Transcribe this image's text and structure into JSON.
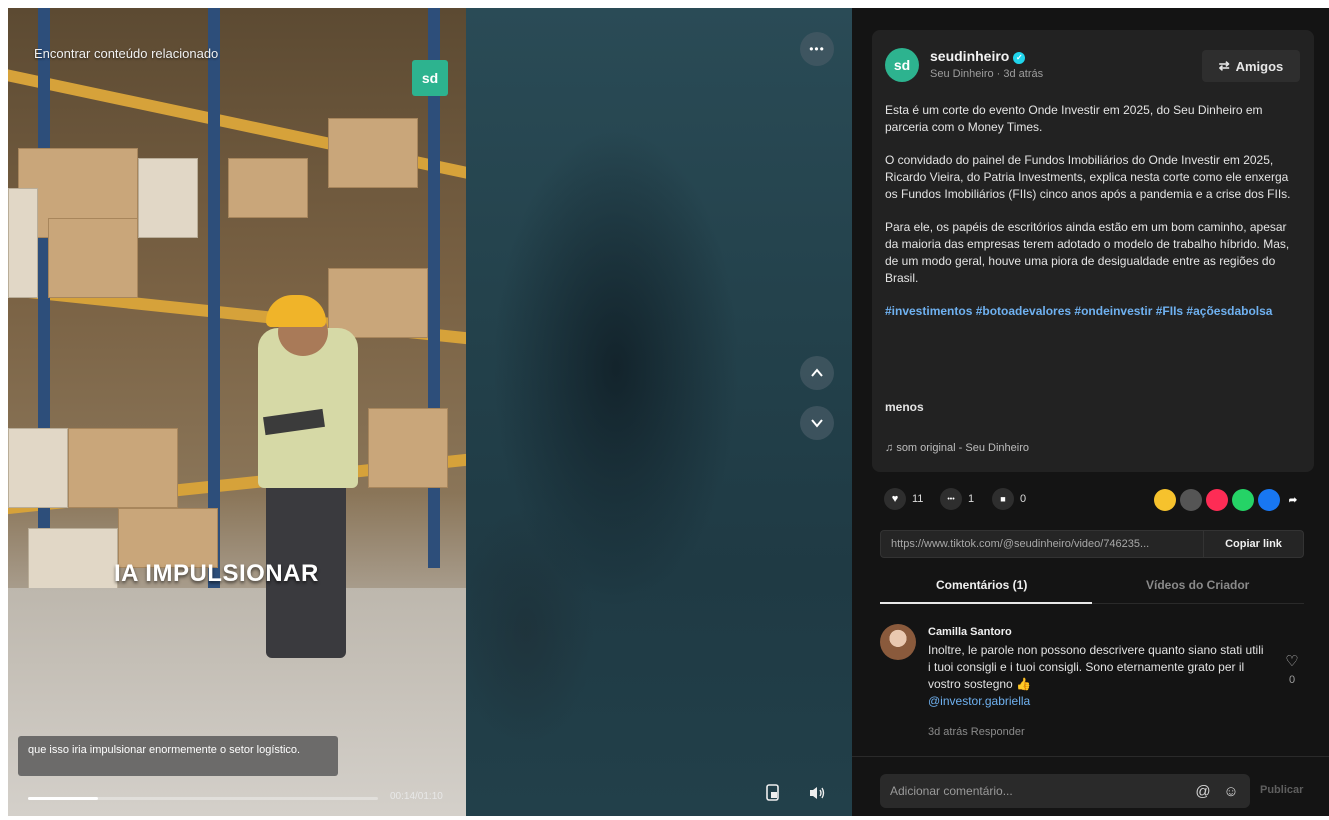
{
  "video": {
    "related_search": "Encontrar conteúdo relacionado",
    "brand_badge": "sd",
    "caption": "IA IMPULSIONAR",
    "subtitle": "que isso iria impulsionar enormemente o setor logístico.",
    "time": "00:14/01:10",
    "progress_fraction": 0.2,
    "more_label": "•••",
    "up_label": "⌃",
    "down_label": "⌄",
    "float_icon": "picture-in-picture-icon",
    "volume_icon": "volume-icon"
  },
  "author": {
    "avatar_text": "sd",
    "name": "seudinheiro",
    "verified_mark": "✓",
    "subtitle": "Seu Dinheiro · 3d atrás",
    "friends_button": "Amigos",
    "friends_icon": "⇄"
  },
  "description": {
    "paragraphs": [
      "Esta é um corte do evento Onde Investir em 2025, do Seu Dinheiro em parceria com o Money Times.",
      "O convidado do painel de Fundos Imobiliários do Onde Investir em 2025, Ricardo Vieira, do Patria Investments, explica nesta corte como ele enxerga os Fundos Imobiliários (FIIs) cinco anos após a pandemia e a crise dos FIIs.",
      "Para ele, os papéis de escritórios ainda estão em um bom caminho, apesar da maioria das empresas terem adotado o modelo de trabalho híbrido. Mas, de um modo geral, houve uma piora de desigualdade entre as regiões do Brasil."
    ],
    "hashtags": "#investimentos #botoadevalores #ondeinvestir #FIIs #açõesdabolsa",
    "less": "menos",
    "music_icon": "♫",
    "music": "som original - Seu Dinheiro"
  },
  "stats": {
    "likes": "11",
    "comments": "1",
    "saves": "0",
    "like_icon": "♥",
    "comment_icon": "•••",
    "save_icon": "■",
    "share_colors": [
      "#f6c22d",
      "#555555",
      "#fe2c55",
      "#25d366",
      "#1877f2"
    ],
    "share_arrow": "➦"
  },
  "link": {
    "url": "https://www.tiktok.com/@seudinheiro/video/746235...",
    "copy_label": "Copiar link"
  },
  "tabs": {
    "comments": "Comentários (1)",
    "creator_videos": "Vídeos do Criador"
  },
  "comment": {
    "author": "Camilla Santoro",
    "text": "Inoltre, le parole non possono descrivere quanto siano stati utili i tuoi consigli e i tuoi consigli. Sono eternamente grato per il vostro sostegno 👍",
    "mention": "@investor.gabriella",
    "meta": "3d atrás   Responder",
    "like_icon": "♡",
    "likes": "0"
  },
  "input": {
    "placeholder": "Adicionar comentário...",
    "mention_icon": "@",
    "emoji_icon": "☺",
    "post_label": "Publicar"
  }
}
